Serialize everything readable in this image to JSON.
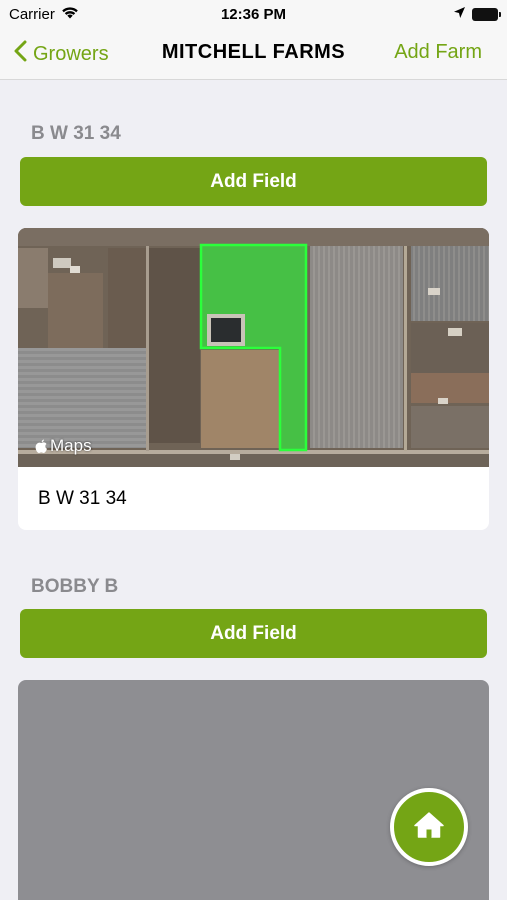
{
  "status_bar": {
    "carrier": "Carrier",
    "time": "12:36 PM",
    "icons": [
      "wifi-icon",
      "location-arrow-icon",
      "battery-icon"
    ]
  },
  "nav": {
    "back_label": "Growers",
    "back_icon": "chevron-left-icon",
    "title": "MITCHELL FARMS",
    "action_label": "Add Farm"
  },
  "farms": [
    {
      "name": "B W 31 34",
      "add_field_label": "Add Field",
      "fields": [
        {
          "name": "B W 31 34",
          "map_credit": "Maps"
        }
      ]
    },
    {
      "name": "BOBBY B",
      "add_field_label": "Add Field",
      "fields": []
    }
  ],
  "fab": {
    "icon": "home-icon"
  },
  "colors": {
    "accent": "#74a515",
    "boundary": "#2bff3b",
    "section_text": "#8a8a8e",
    "background": "#efeff4"
  }
}
